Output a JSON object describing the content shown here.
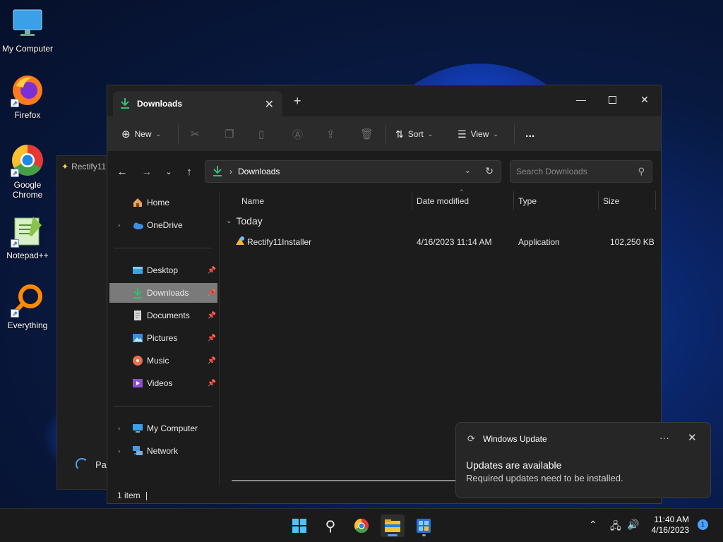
{
  "desktop": {
    "icons": [
      {
        "label": "My Computer"
      },
      {
        "label": "Firefox"
      },
      {
        "label": "Google Chrome"
      },
      {
        "label": "Notepad++"
      },
      {
        "label": "Everything"
      }
    ]
  },
  "bg_window": {
    "title": "Rectify11",
    "status": "Pat"
  },
  "explorer": {
    "tab_title": "Downloads",
    "toolbar": {
      "new_label": "New",
      "sort_label": "Sort",
      "view_label": "View",
      "more_label": "..."
    },
    "address": {
      "path": "Downloads",
      "search_placeholder": "Search Downloads"
    },
    "nav": {
      "home": "Home",
      "onedrive": "OneDrive",
      "desktop": "Desktop",
      "downloads": "Downloads",
      "documents": "Documents",
      "pictures": "Pictures",
      "music": "Music",
      "videos": "Videos",
      "my_computer": "My Computer",
      "network": "Network"
    },
    "columns": {
      "name": "Name",
      "date": "Date modified",
      "type": "Type",
      "size": "Size"
    },
    "group": "Today",
    "files": [
      {
        "name": "Rectify11Installer",
        "date": "4/16/2023 11:14 AM",
        "type": "Application",
        "size": "102,250 KB"
      }
    ],
    "status": "1 item"
  },
  "toast": {
    "app": "Windows Update",
    "heading": "Updates are available",
    "body": "Required updates need to be installed."
  },
  "taskbar": {
    "time": "11:40 AM",
    "date": "4/16/2023",
    "badge": "1"
  }
}
